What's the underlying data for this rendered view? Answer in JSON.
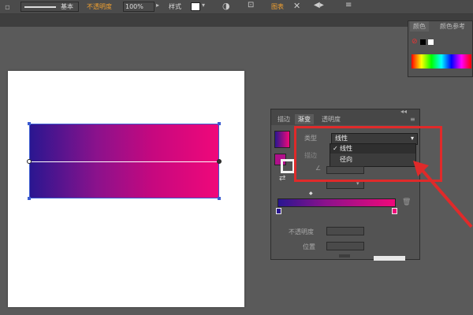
{
  "toolbar": {
    "stroke_value": "基本",
    "opacity_label": "不透明度",
    "opacity_value": "100%",
    "style_label": "样式",
    "doc_setup": "图表"
  },
  "color_panel": {
    "tabs": [
      "颜色",
      "颜色参考"
    ]
  },
  "gradient_panel": {
    "tabs": [
      "描边",
      "渐变",
      "透明度"
    ],
    "type_label": "类型",
    "type_value": "线性",
    "type_options": [
      "线性",
      "径向"
    ],
    "selected_option": "线性",
    "stroke_label": "描边",
    "opacity_label": "不透明度",
    "location_label": "位置"
  },
  "colors": {
    "gradient_start": "#2a1690",
    "gradient_end": "#f0087a",
    "highlight": "#e02a2a"
  }
}
